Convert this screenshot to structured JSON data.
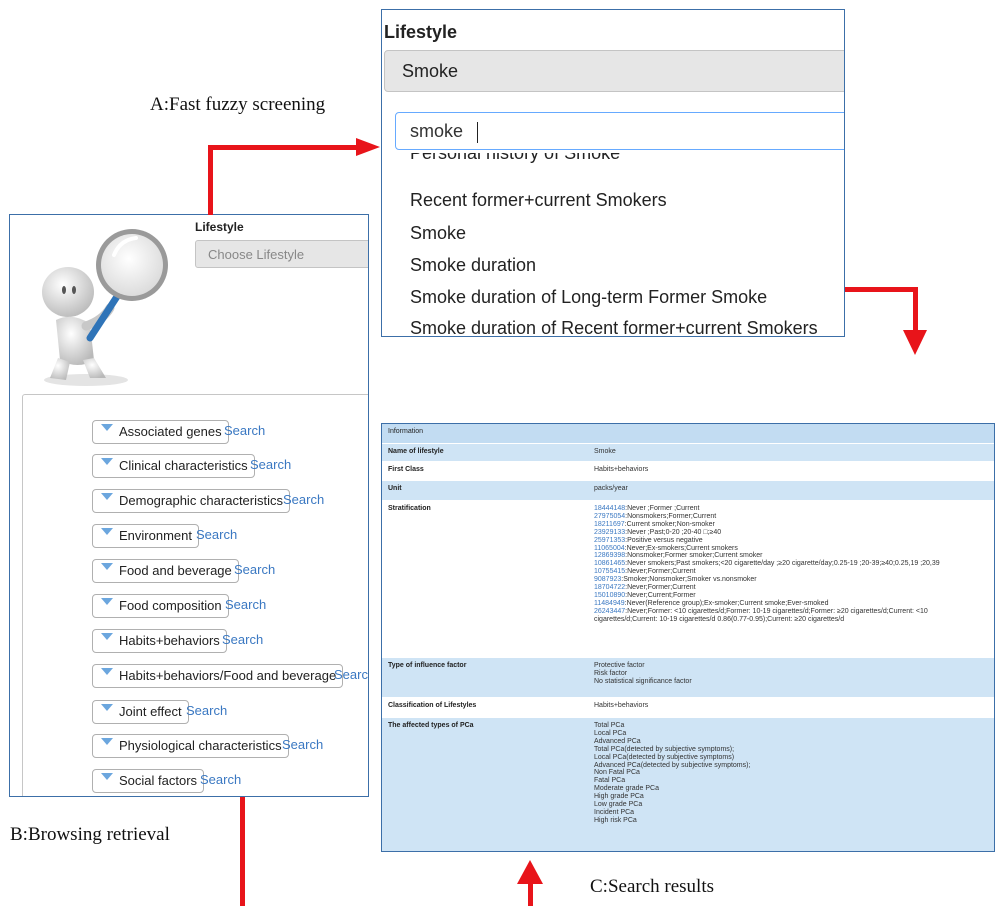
{
  "captions": {
    "a": "A:Fast fuzzy screening",
    "b": "B:Browsing retrieval",
    "c": "C:Search results"
  },
  "panel_a": {
    "title": "Lifestyle",
    "selected": "Smoke",
    "search_value": "smoke",
    "options": [
      "Personal history of Smoke",
      "Recent former+current Smokers",
      "Smoke",
      "Smoke duration",
      "Smoke duration of Long-term Former Smoke",
      "Smoke duration of Recent former+current Smokers"
    ]
  },
  "panel_b": {
    "title": "Lifestyle",
    "placeholder": "Choose Lifestyle",
    "search_link": "Search",
    "categories": [
      "Associated genes",
      "Clinical characteristics",
      "Demographic characteristics",
      "Environment",
      "Food and beverage",
      "Food composition",
      "Habits+behaviors",
      "Habits+behaviors/Food and beverage",
      "Joint effect",
      "Physiological characteristics",
      "Social factors"
    ]
  },
  "panel_c": {
    "header": "Information",
    "rows": [
      {
        "label": "Name of lifestyle",
        "value": "Smoke"
      },
      {
        "label": "First Class",
        "value": "Habits+behaviors"
      },
      {
        "label": "Unit",
        "value": "packs/year"
      },
      {
        "label": "Stratification",
        "lines": [
          {
            "pmid": "18444148",
            "text": ":Never ;Former ;Current"
          },
          {
            "pmid": "27975054",
            "text": ":Nonsmokers;Former;Current"
          },
          {
            "pmid": "18211697",
            "text": ":Current smoker;Non-smoker"
          },
          {
            "pmid": "23929133",
            "text": ":Never ;Past;0-20 ;20-40 □;≥40"
          },
          {
            "pmid": "25971353",
            "text": ":Positive versus negative"
          },
          {
            "pmid": "11065004",
            "text": ":Never;Ex-smokers;Current smokers"
          },
          {
            "pmid": "12869398",
            "text": ":Nonsmoker;Former smoker;Current smoker"
          },
          {
            "pmid": "10861465",
            "text": ":Never smokers;Past smokers;<20 cigarette/day ;≥20 cigarette/day;0.25-19 ;20-39;≥40;0.25,19 ;20,39"
          },
          {
            "pmid": "10755415",
            "text": ":Never;Former;Current"
          },
          {
            "pmid": "9087923",
            "text": ":Smoker;Nonsmoker;Smoker vs.nonsmoker"
          },
          {
            "pmid": "18704722",
            "text": ":Never;Former;Current"
          },
          {
            "pmid": "15010890",
            "text": ":Never;Current;Former"
          },
          {
            "pmid": "11484949",
            "text": ":Never(Reference group);Ex-smoker;Current smoke;Ever-smoked"
          },
          {
            "pmid": "26243447",
            "text": ":Never;Former: <10 cigarettes/d;Former: 10-19 cigarettes/d;Former: ≥20 cigarettes/d;Current: <10"
          },
          {
            "pmid": "",
            "text": "cigarettes/d;Current: 10-19 cigarettes/d 0.86(0.77-0.95);Current: ≥20 cigarettes/d"
          }
        ]
      },
      {
        "label": "Type of influence factor",
        "lines": [
          {
            "pmid": "",
            "text": "Protective factor"
          },
          {
            "pmid": "",
            "text": "Risk factor"
          },
          {
            "pmid": "",
            "text": "No statistical significance factor"
          }
        ]
      },
      {
        "label": "Classification of Lifestyles",
        "value": "Habits+behaviors"
      },
      {
        "label": "The affected types of PCa",
        "lines": [
          {
            "pmid": "",
            "text": "Total PCa"
          },
          {
            "pmid": "",
            "text": "Local PCa"
          },
          {
            "pmid": "",
            "text": "Advanced PCa"
          },
          {
            "pmid": "",
            "text": "Total PCa(detected by subjective symptoms);"
          },
          {
            "pmid": "",
            "text": "Local PCa(detected by subjective symptoms)"
          },
          {
            "pmid": "",
            "text": "Advanced PCa(detected by subjective symptoms);"
          },
          {
            "pmid": "",
            "text": "Non Fatal PCa"
          },
          {
            "pmid": "",
            "text": "Fatal PCa"
          },
          {
            "pmid": "",
            "text": "Moderate grade PCa"
          },
          {
            "pmid": "",
            "text": "High grade PCa"
          },
          {
            "pmid": "",
            "text": "Low grade PCa"
          },
          {
            "pmid": "",
            "text": "Incident PCa"
          },
          {
            "pmid": "",
            "text": "High risk PCa"
          }
        ]
      }
    ]
  },
  "colors": {
    "arrow": "#e8141a",
    "panel_border": "#3c6fa8",
    "table_blue": "#cfe4f5",
    "link": "#3a78c2"
  }
}
